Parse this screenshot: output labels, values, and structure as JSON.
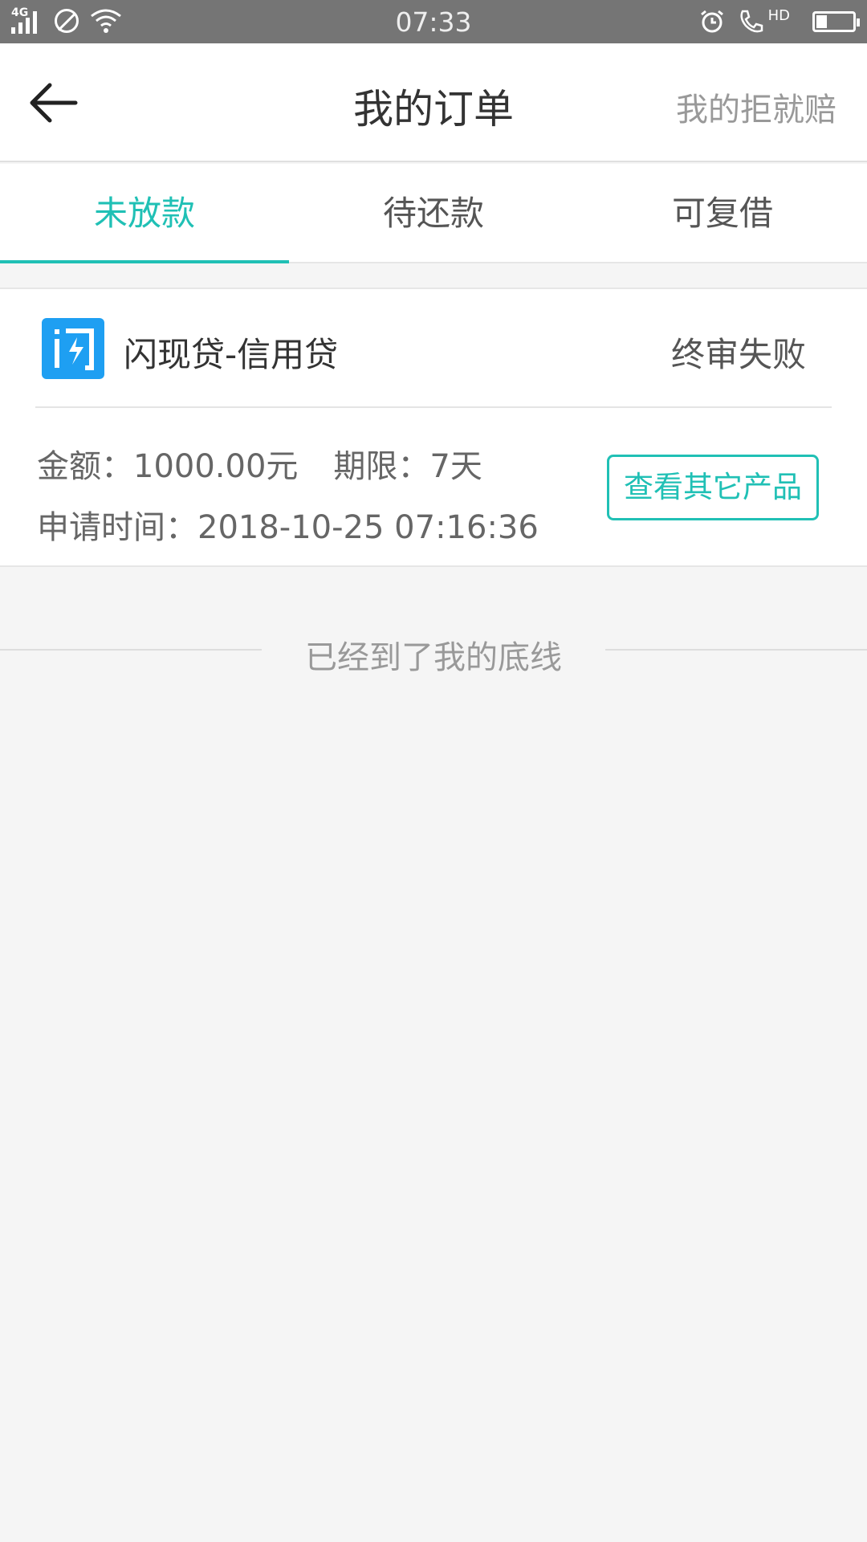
{
  "status_bar": {
    "network": "4G",
    "time": "07:33",
    "call_badge": "HD",
    "battery_level": 0.35
  },
  "header": {
    "title": "我的订单",
    "right_link": "我的拒就赔"
  },
  "tabs": [
    {
      "label": "未放款",
      "active": true
    },
    {
      "label": "待还款",
      "active": false
    },
    {
      "label": "可复借",
      "active": false
    }
  ],
  "order": {
    "product_name": "闪现贷-信用贷",
    "status": "终审失败",
    "amount_text": "金额：1000.00元",
    "term_text": "期限：7天",
    "apply_time_text": "申请时间：2018-10-25 07:16:36",
    "action_button": "查看其它产品"
  },
  "footer_text": "已经到了我的底线",
  "colors": {
    "accent": "#20c0b5",
    "logo_bg": "#1e9ff2",
    "status_bar": "#757575"
  }
}
